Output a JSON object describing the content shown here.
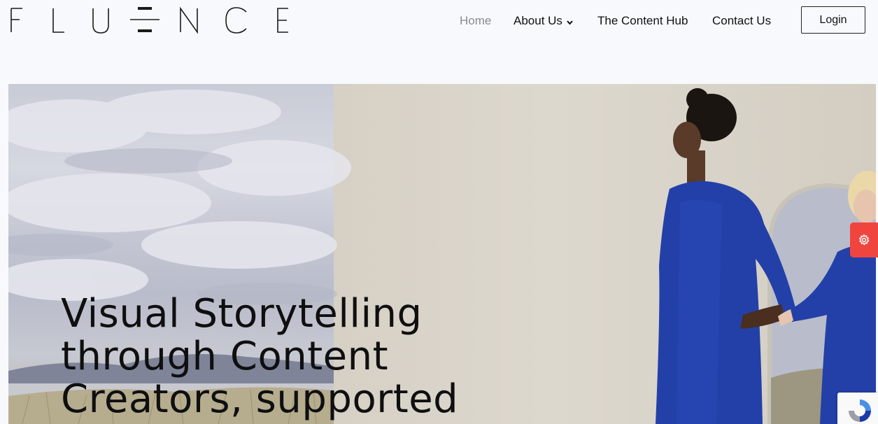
{
  "brand": {
    "logo_text": "FLUENCE"
  },
  "nav": {
    "items": [
      {
        "label": "Home",
        "active": true
      },
      {
        "label": "About Us",
        "has_dropdown": true
      },
      {
        "label": "The Content Hub"
      },
      {
        "label": "Contact Us"
      }
    ],
    "login_label": "Login"
  },
  "hero": {
    "headline_lines": [
      "Visual Storytelling",
      "through Content",
      "Creators, supported"
    ]
  },
  "widgets": {
    "settings_icon": "gear-icon",
    "recaptcha_icon": "recaptcha-icon"
  },
  "colors": {
    "settings_tab": "#f0453f",
    "dress_blue": "#2340a8",
    "nav_active": "#8a8a8a"
  }
}
